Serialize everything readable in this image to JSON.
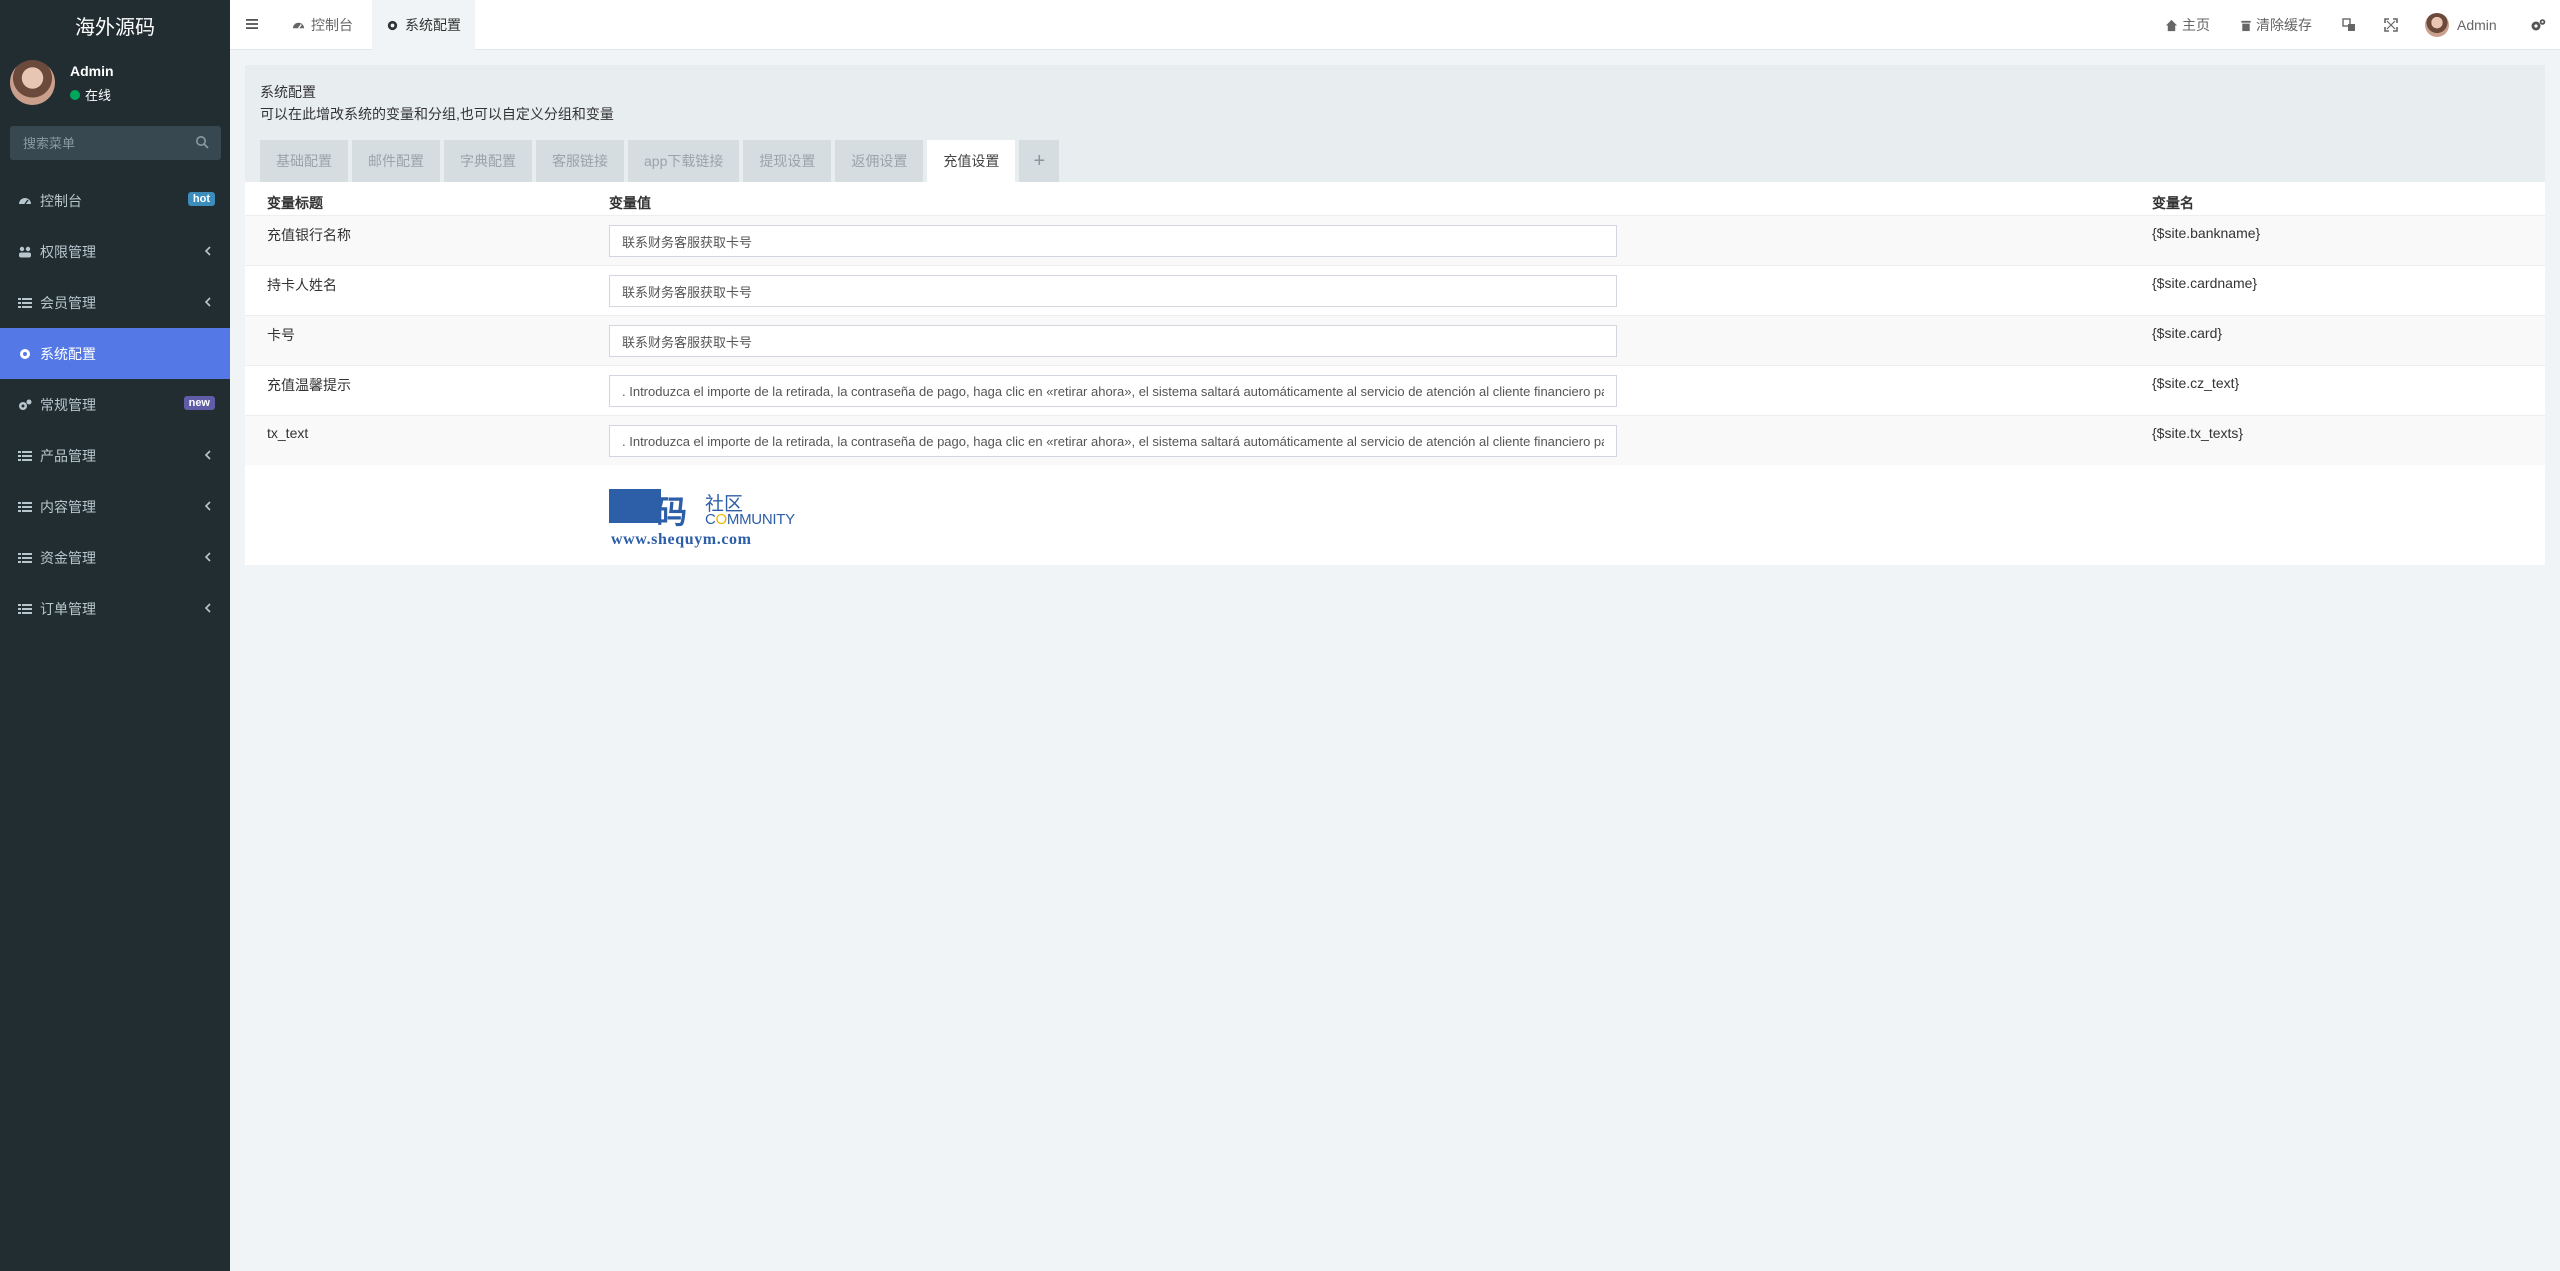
{
  "sidebar": {
    "brand": "海外源码",
    "user": {
      "name": "Admin",
      "status": "在线"
    },
    "search_placeholder": "搜索菜单",
    "items": [
      {
        "label": "控制台",
        "badge": "hot"
      },
      {
        "label": "权限管理"
      },
      {
        "label": "会员管理"
      },
      {
        "label": "系统配置"
      },
      {
        "label": "常规管理",
        "badge": "new"
      },
      {
        "label": "产品管理"
      },
      {
        "label": "内容管理"
      },
      {
        "label": "资金管理"
      },
      {
        "label": "订单管理"
      }
    ]
  },
  "header": {
    "tabs": [
      {
        "label": "控制台"
      },
      {
        "label": "系统配置"
      }
    ],
    "right": {
      "home": "主页",
      "clear_cache": "清除缓存",
      "admin": "Admin"
    }
  },
  "panel": {
    "title": "系统配置",
    "description": "可以在此增改系统的变量和分组,也可以自定义分组和变量",
    "tabs": [
      "基础配置",
      "邮件配置",
      "字典配置",
      "客服链接",
      "app下载链接",
      "提现设置",
      "返佣设置",
      "充值设置"
    ],
    "plus": "+",
    "table": {
      "headers": [
        "变量标题",
        "变量值",
        "变量名"
      ],
      "rows": [
        {
          "title": "充值银行名称",
          "value": "联系财务客服获取卡号",
          "name": "{$site.bankname}"
        },
        {
          "title": "持卡人姓名",
          "value": "联系财务客服获取卡号",
          "name": "{$site.cardname}"
        },
        {
          "title": "卡号",
          "value": "联系财务客服获取卡号",
          "name": "{$site.card}"
        },
        {
          "title": "充值温馨提示",
          "value": ". Introduzca el importe de la retirada, la contraseña de pago, haga clic en «retirar ahora», el sistema saltará automáticamente al servicio de atención al cliente financiero para",
          "name": "{$site.cz_text}"
        },
        {
          "title": "tx_text",
          "value": ". Introduzca el importe de la retirada, la contraseña de pago, haga clic en «retirar ahora», el sistema saltará automáticamente al servicio de atención al cliente financiero para",
          "name": "{$site.tx_texts}"
        }
      ]
    }
  },
  "watermark": {
    "big": "码",
    "community_cn": "社区",
    "community_pre": "C",
    "community_o": "O",
    "community_post": "MMUNITY",
    "url": "www.shequym.com"
  }
}
